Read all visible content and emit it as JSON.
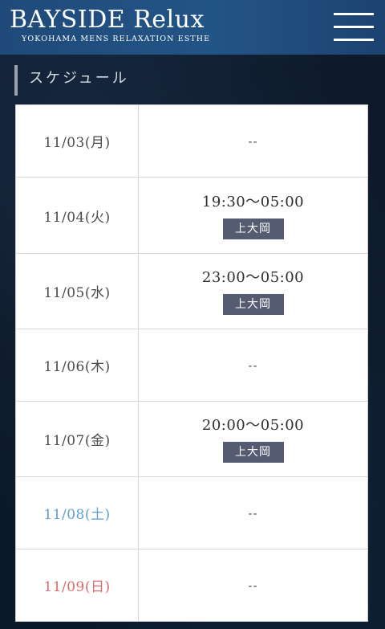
{
  "header": {
    "logo_text": "BAYSIDE Relux",
    "tagline": "YOKOHAMA MENS RELAXATION ESTHE"
  },
  "section": {
    "title": "スケジュール"
  },
  "schedule": [
    {
      "date": "11/03(月)",
      "day_type": "weekday",
      "time": "--",
      "location": ""
    },
    {
      "date": "11/04(火)",
      "day_type": "weekday",
      "time": "19:30〜05:00",
      "location": "上大岡"
    },
    {
      "date": "11/05(水)",
      "day_type": "weekday",
      "time": "23:00〜05:00",
      "location": "上大岡"
    },
    {
      "date": "11/06(木)",
      "day_type": "weekday",
      "time": "--",
      "location": ""
    },
    {
      "date": "11/07(金)",
      "day_type": "weekday",
      "time": "20:00〜05:00",
      "location": "上大岡"
    },
    {
      "date": "11/08(土)",
      "day_type": "saturday",
      "time": "--",
      "location": ""
    },
    {
      "date": "11/09(日)",
      "day_type": "sunday",
      "time": "--",
      "location": ""
    }
  ],
  "colors": {
    "header_bg": "#235486",
    "saturday": "#5a9fd6",
    "sunday": "#d96b6b",
    "location_badge": "#555c72"
  },
  "icons": {
    "menu": "hamburger-menu-icon"
  }
}
